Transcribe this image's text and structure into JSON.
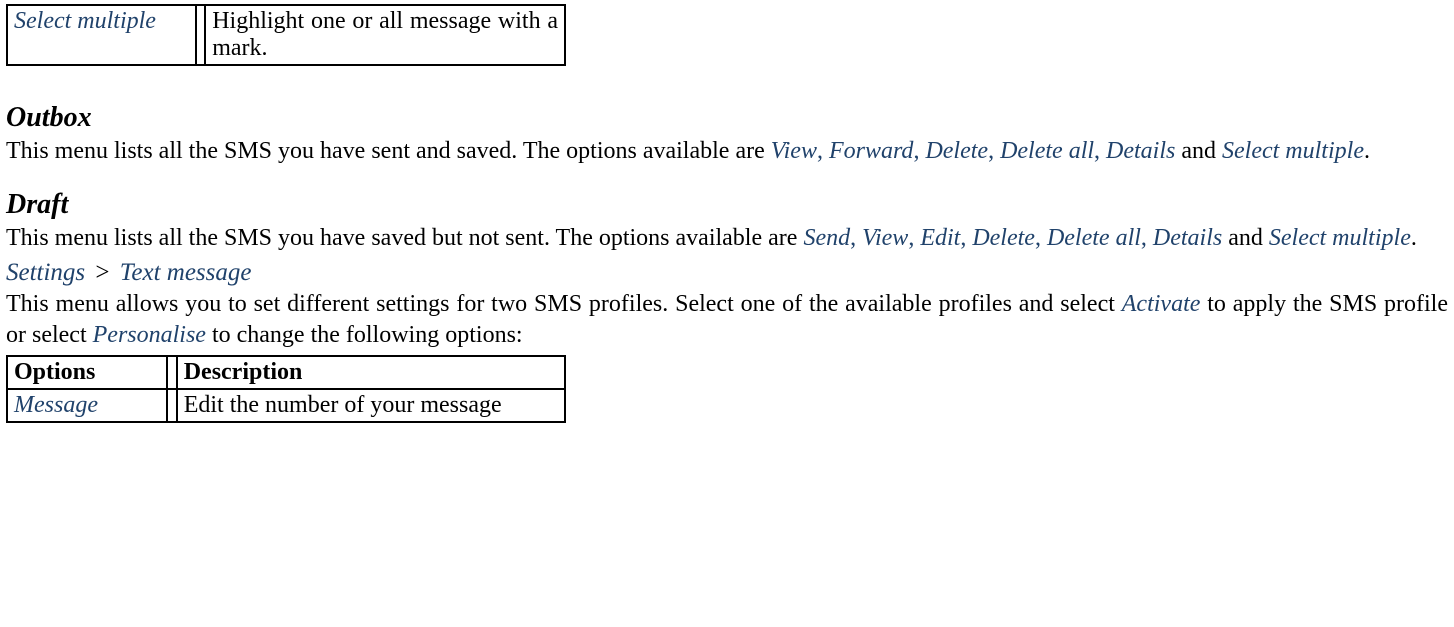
{
  "table1": {
    "option": "Select multiple",
    "description": "Highlight one or all message with a mark."
  },
  "outbox": {
    "heading": "Outbox",
    "body_part1": "This menu lists all the SMS you have sent and saved. The options available are ",
    "opt1": "View",
    "sep12": ", ",
    "opt2": "Forward",
    "sep23": ", ",
    "opt3": "Delete",
    "sep34": ", ",
    "opt4": "Delete all",
    "sep45": ", ",
    "opt5": "Details",
    "sep56": " and ",
    "opt6": "Select multiple",
    "body_tail": "."
  },
  "draft": {
    "heading": "Draft",
    "body_part1": "This menu lists all the SMS you have saved but not sent. The options available are ",
    "opt1": "Send",
    "sep12": ", ",
    "opt2": "View",
    "sep23": ", ",
    "opt3": "Edit",
    "sep34": ", ",
    "opt4": "Delete",
    "sep45": ", ",
    "opt5": "Delete all",
    "sep56": ", ",
    "opt6": "Details",
    "sep67": " and ",
    "opt7": "Select multiple",
    "body_tail": "."
  },
  "settings": {
    "crumb_a": "Settings",
    "crumb_sep": ">",
    "crumb_b": "Text message",
    "body_part1": "This menu allows you to set different settings for two SMS profiles. Select one of the available profiles and select ",
    "opt1": "Activate",
    "mid": " to apply the SMS profile or select ",
    "opt2": "Personalise",
    "body_tail": " to change the following options:"
  },
  "table2": {
    "header_options": "Options",
    "header_description": "Description",
    "row_option": "Message",
    "row_description": "Edit the number of your message"
  }
}
